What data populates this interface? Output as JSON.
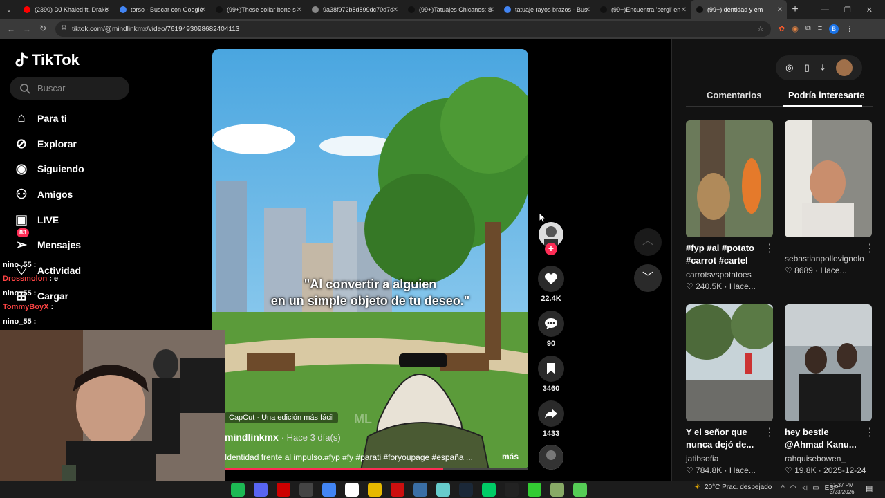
{
  "browser": {
    "tabs": [
      {
        "label": "(2390) DJ Khaled ft. Drake",
        "color": "#ff0000",
        "active": false
      },
      {
        "label": "torso - Buscar con Google",
        "color": "#4285f4",
        "active": false
      },
      {
        "label": "(99+)These collar bone s",
        "color": "#111111",
        "active": false
      },
      {
        "label": "9a38f972b8d899dc70d7d",
        "color": "#888888",
        "active": false
      },
      {
        "label": "(99+)Tatuajes Chicanos: S",
        "color": "#111111",
        "active": false
      },
      {
        "label": "tatuaje rayos brazos - Bus",
        "color": "#4285f4",
        "active": false
      },
      {
        "label": "(99+)Encuentra 'sergi' en",
        "color": "#111111",
        "active": false
      },
      {
        "label": "(99+)Identidad y em",
        "color": "#111111",
        "active": true
      }
    ],
    "url": "tiktok.com/@mindlinkmx/video/7619493098682404113"
  },
  "sidebar": {
    "brand": "TikTok",
    "search_placeholder": "Buscar",
    "items": [
      {
        "label": "Para ti",
        "icon": "home-icon"
      },
      {
        "label": "Explorar",
        "icon": "compass-icon"
      },
      {
        "label": "Siguiendo",
        "icon": "following-avatar-icon"
      },
      {
        "label": "Amigos",
        "icon": "friends-icon"
      },
      {
        "label": "LIVE",
        "icon": "live-icon"
      },
      {
        "label": "Mensajes",
        "icon": "messages-icon",
        "badge": "83"
      },
      {
        "label": "Actividad",
        "icon": "activity-icon"
      },
      {
        "label": "Cargar",
        "icon": "upload-icon"
      }
    ]
  },
  "video": {
    "caption": "\"Al convertir a alguien\nen un simple objeto de tu deseo.\"",
    "capcut": "CapCut · Una edición más fácil",
    "author": "mindlinkmx",
    "time": "· Hace 3 día(s)",
    "description": "Identidad frente al impulso.#fyp #fy #parati #foryoupage #españa ...",
    "more": "más",
    "watermark": "ML",
    "progress_fraction": 0.72
  },
  "actions": {
    "likes": "22.4K",
    "comments": "90",
    "saves": "3460",
    "shares": "1433"
  },
  "right_panel": {
    "tabs": [
      "Comentarios",
      "Podría interesarte"
    ],
    "cards": [
      {
        "title": "#fyp #ai #potato #carrot #cartel",
        "author": "carrotsvspotatoes",
        "likes": "240.5K",
        "time": "· Hace..."
      },
      {
        "title": "",
        "author": "sebastianpollovignolo",
        "likes": "8689",
        "time": "· Hace..."
      },
      {
        "title": "Y el señor que nunca dejó de...",
        "author": "jatibsofia",
        "likes": "784.8K",
        "time": "· Hace..."
      },
      {
        "title": "hey bestie @Ahmad Kanu...",
        "author": "rahquisebowen_",
        "likes": "19.8K",
        "time": "· 2025-12-24"
      }
    ]
  },
  "chat": [
    {
      "user": "nino_55",
      "msg": ":",
      "color": "#ffffff"
    },
    {
      "user": "Drossmolon",
      "msg": ": e",
      "color": "#ff4444"
    },
    {
      "user": "nino_55",
      "msg": ":",
      "color": "#ffffff"
    },
    {
      "user": "TommyBoyX",
      "msg": ":",
      "color": "#ff4444"
    },
    {
      "user": "nino_55",
      "msg": ":",
      "color": "#ffffff"
    }
  ],
  "taskbar": {
    "weather": "20°C  Prac. despejado",
    "lang": "ESP",
    "time": "11:37 PM",
    "date": "3/23/2026"
  }
}
